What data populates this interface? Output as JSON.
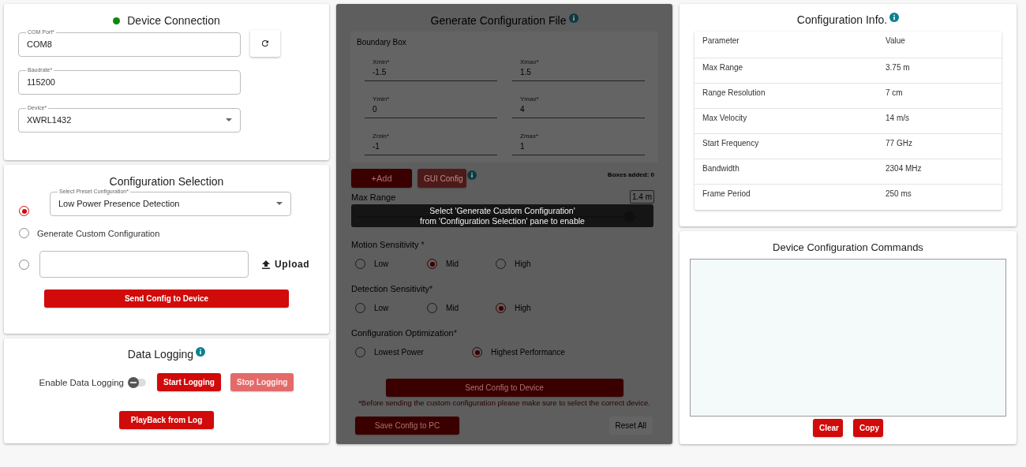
{
  "device_connection": {
    "title": "Device Connection",
    "connected": true,
    "com_port": {
      "label": "COM Port*",
      "value": "COM8"
    },
    "baudrate": {
      "label": "Baudrate*",
      "value": "115200"
    },
    "device": {
      "label": "Device*",
      "value": "XWRL1432"
    }
  },
  "configuration_selection": {
    "title": "Configuration Selection",
    "options": [
      {
        "kind": "preset",
        "selected": true,
        "label": "Select Preset Configuration*",
        "value": "Low Power Presence Detection"
      },
      {
        "kind": "custom",
        "selected": false,
        "label": "Generate Custom Configuration"
      },
      {
        "kind": "file",
        "selected": false,
        "button": "Upload"
      }
    ],
    "send_button": "Send Config to Device"
  },
  "data_logging": {
    "title": "Data Logging",
    "toggle": {
      "label": "Enable Data Logging",
      "on": false
    },
    "buttons": [
      {
        "label": "Start Logging",
        "disabled": false
      },
      {
        "label": "Stop Logging",
        "disabled": true
      }
    ],
    "playback_button": "PlayBack from Log"
  },
  "generate_configuration": {
    "title": "Generate Configuration File",
    "disabled": true,
    "boundary_box": {
      "title": "Boundary Box",
      "fields": [
        {
          "label": "Xmin*",
          "value": "-1.5"
        },
        {
          "label": "Xmax*",
          "value": "1.5"
        },
        {
          "label": "Ymin*",
          "value": "0"
        },
        {
          "label": "Ymax*",
          "value": "4"
        },
        {
          "label": "Zmin*",
          "value": "-1"
        },
        {
          "label": "Zmax*",
          "value": "1"
        }
      ]
    },
    "add_button": "+Add",
    "gui_config_button": "GUI Config",
    "boxes_added": "Boxes added: 0",
    "max_range": {
      "label": "Max Range",
      "value": "1.4 m",
      "level": 0.97
    },
    "groups": [
      {
        "label": "Motion Sensitivity",
        "mark": "*",
        "options": [
          {
            "label": "Low",
            "selected": false
          },
          {
            "label": "Mid",
            "selected": true
          },
          {
            "label": "High",
            "selected": false
          }
        ]
      },
      {
        "label": "Detection Sensitivity",
        "mark": "*",
        "options": [
          {
            "label": "Low",
            "selected": false
          },
          {
            "label": "Mid",
            "selected": false
          },
          {
            "label": "High",
            "selected": true
          }
        ]
      },
      {
        "label": "Configuration Optimization",
        "mark": "*",
        "options": [
          {
            "label": "Lowest Power",
            "selected": false
          },
          {
            "label": "Highest Performance",
            "selected": true
          }
        ]
      }
    ],
    "send_button": "Send Config to Device",
    "note": "*Before sending the custom configuration please make sure to select the correct device.",
    "save_button": "Save Config to PC",
    "reset_button": "Reset All",
    "tooltip": [
      "Select 'Generate Custom Configuration'",
      "from 'Configuration Selection' pane to enable"
    ]
  },
  "configuration_info": {
    "title": "Configuration Info.",
    "columns": [
      "Parameter",
      "Value"
    ],
    "rows": [
      [
        "Max Range",
        "3.75 m"
      ],
      [
        "Range Resolution",
        "7 cm"
      ],
      [
        "Max Velocity",
        "14 m/s"
      ],
      [
        "Start Frequency",
        "77 GHz"
      ],
      [
        "Bandwidth",
        "2304 MHz"
      ],
      [
        "Frame Period",
        "250 ms"
      ]
    ]
  },
  "commands": {
    "title": "Device Configuration Commands",
    "buttons": [
      "Clear",
      "Copy"
    ]
  }
}
